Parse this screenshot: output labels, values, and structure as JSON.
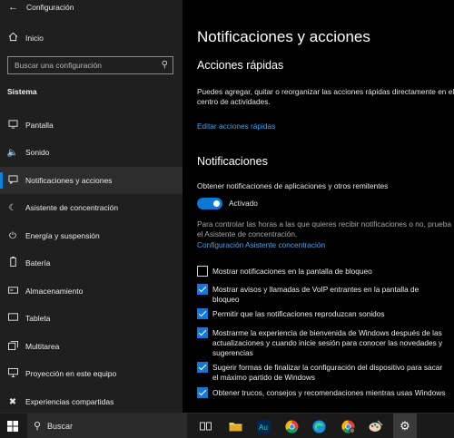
{
  "window": {
    "title": "Configuración",
    "back_icon": "arrow-left-icon"
  },
  "sidebar": {
    "home_label": "Inicio",
    "search_placeholder": "Buscar una configuración",
    "section": "Sistema",
    "items": [
      {
        "label": "Pantalla",
        "icon": "monitor-icon",
        "active": false
      },
      {
        "label": "Sonido",
        "icon": "speaker-icon",
        "active": false
      },
      {
        "label": "Notificaciones y acciones",
        "icon": "notification-icon",
        "active": true
      },
      {
        "label": "Asistente de concentración",
        "icon": "moon-icon",
        "active": false
      },
      {
        "label": "Energía y suspensión",
        "icon": "power-icon",
        "active": false
      },
      {
        "label": "Batería",
        "icon": "battery-icon",
        "active": false
      },
      {
        "label": "Almacenamiento",
        "icon": "storage-icon",
        "active": false
      },
      {
        "label": "Tableta",
        "icon": "tablet-icon",
        "active": false
      },
      {
        "label": "Multitarea",
        "icon": "multitask-icon",
        "active": false
      },
      {
        "label": "Proyección en este equipo",
        "icon": "projection-icon",
        "active": false
      },
      {
        "label": "Experiencias compartidas",
        "icon": "share-icon",
        "active": false
      }
    ]
  },
  "main": {
    "title": "Notificaciones y acciones",
    "quick": {
      "heading": "Acciones rápidas",
      "desc": "Puedes agregar, quitar o reorganizar las acciones rápidas directamente en el centro de actividades.",
      "link": "Editar acciones rápidas"
    },
    "notif": {
      "heading": "Notificaciones",
      "get_label": "Obtener notificaciones de aplicaciones y otros remitentes",
      "toggle_label": "Activado",
      "toggle_on": true,
      "hint": "Para controlar las horas a las que quieres recibir notificaciones o no, prueba el Asistente de concentración.",
      "hint_link": "Configuración Asistente concentración"
    },
    "checks": [
      {
        "label": "Mostrar notificaciones en la pantalla de bloqueo",
        "checked": false
      },
      {
        "label": "Mostrar avisos y llamadas de VoIP entrantes en la pantalla de bloqueo",
        "checked": true
      },
      {
        "label": "Permitir que las notificaciones reproduzcan sonidos",
        "checked": true
      },
      {
        "label": "Mostrarme la experiencia de bienvenida de Windows después de las actualizaciones y cuando inicie sesión para conocer las novedades y sugerencias",
        "checked": true
      },
      {
        "label": "Sugerir formas de finalizar la configuración del dispositivo para sacar el máximo partido de Windows",
        "checked": true
      },
      {
        "label": "Obtener trucos, consejos y recomendaciones mientras usas Windows",
        "checked": true
      }
    ]
  },
  "taskbar": {
    "search_label": "Buscar",
    "apps": [
      "task-view-icon",
      "file-explorer-icon",
      "audition-icon",
      "chrome-icon",
      "edge-icon",
      "chrome-profile-icon",
      "paint-icon",
      "settings-icon"
    ]
  },
  "colors": {
    "accent": "#0a78d4",
    "link": "#4ca0ec",
    "sidebar_bg": "#1f1f1f",
    "main_bg": "#000000"
  }
}
